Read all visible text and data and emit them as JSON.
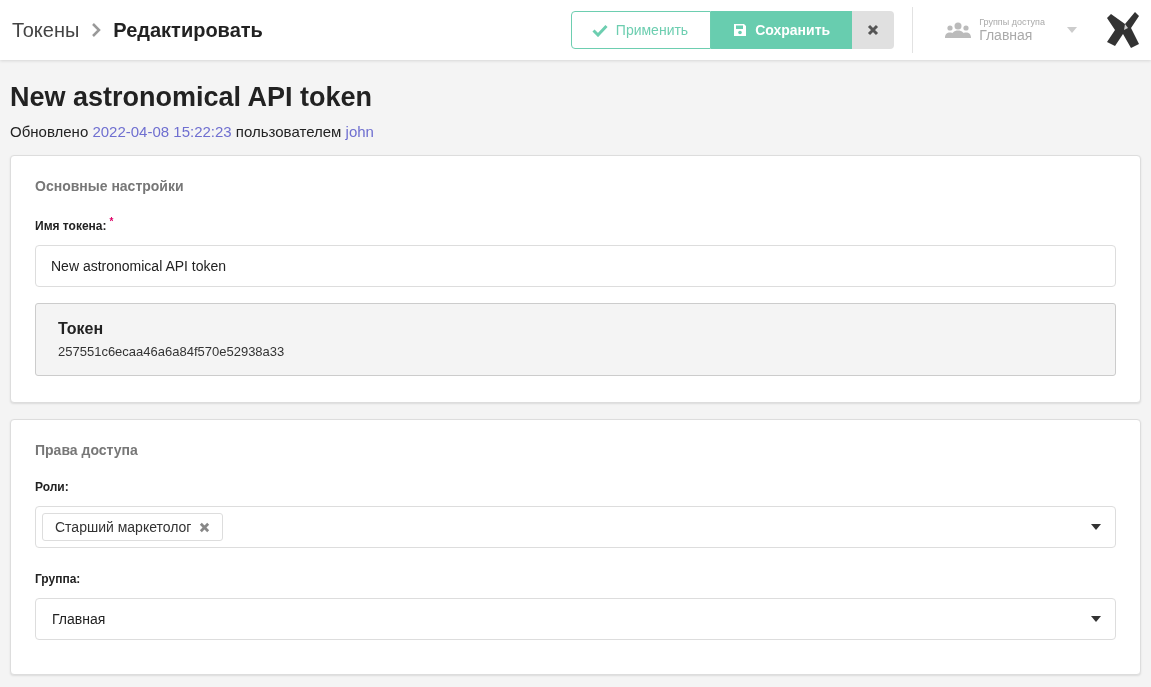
{
  "breadcrumb": {
    "parent": "Токены",
    "current": "Редактировать"
  },
  "actions": {
    "apply": "Применить",
    "save": "Сохранить"
  },
  "access_group": {
    "label": "Группы доступа",
    "value": "Главная"
  },
  "page": {
    "title": "New astronomical API token",
    "updated_prefix": "Обновлено",
    "updated_at": "2022-04-08 15:22:23",
    "by_prefix": "пользователем",
    "user": "john"
  },
  "main_settings": {
    "heading": "Основные настройки",
    "name_label": "Имя токена:",
    "required_mark": "*",
    "name_value": "New astronomical API token",
    "token_title": "Токен",
    "token_value": "257551c6ecaa46a6a84f570e52938a33"
  },
  "access": {
    "heading": "Права доступа",
    "roles_label": "Роли:",
    "roles": [
      "Старший маркетолог"
    ],
    "group_label": "Группа:",
    "group_value": "Главная"
  }
}
